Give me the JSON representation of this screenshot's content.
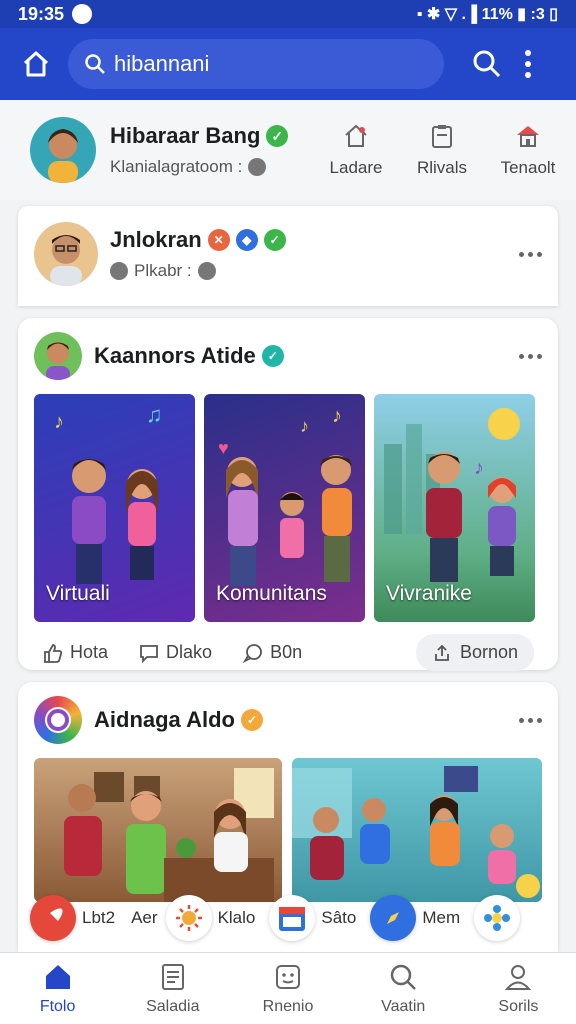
{
  "status_bar": {
    "time": "19:35",
    "right": "▪ ✱ ▽ .▐ 11% ▮ :3 ▯"
  },
  "search": {
    "value": "hibannani"
  },
  "profile": {
    "name": "Hibaraar Bang",
    "sub": "Klanialagratoom :"
  },
  "quick_actions": [
    {
      "label": "Ladare",
      "icon": "home-icon"
    },
    {
      "label": "Rlivals",
      "icon": "clipboard-icon"
    },
    {
      "label": "Tenaolt",
      "icon": "house-red-icon"
    }
  ],
  "post1": {
    "name": "Jnlokran",
    "sub": "Plkabr :"
  },
  "post2": {
    "name": "Kaannors Atide",
    "thumbs": [
      "Virtuali",
      "Komunitans",
      "Vivranike"
    ],
    "actions": [
      "Hota",
      "Dlako",
      "B0n"
    ],
    "share": "Bornon"
  },
  "post3": {
    "name": "Aidnaga Aldo"
  },
  "chips": [
    "Lbt2",
    "Aer",
    "Klalo",
    "Sâto",
    "Mem"
  ],
  "nav": [
    "Ftolo",
    "Saladia",
    "Rnenio",
    "Vaatin",
    "Sorils"
  ],
  "colors": {
    "brand": "#2347c8",
    "verified": "#3cb54a"
  }
}
